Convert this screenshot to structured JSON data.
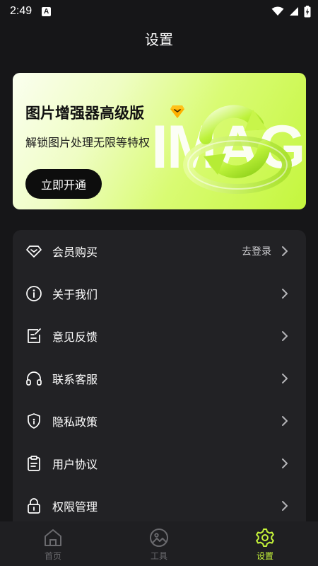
{
  "status_bar": {
    "time": "2:49",
    "notification_letter": "A"
  },
  "header": {
    "title": "设置"
  },
  "banner": {
    "title": "图片增强器高级版",
    "subtitle": "解锁图片处理无限等特权",
    "button_label": "立即开通",
    "background_text": "IMAGE",
    "accent_color": "#c4f63d"
  },
  "menu": {
    "items": [
      {
        "label": "会员购买",
        "right_text": "去登录",
        "icon": "diamond-icon"
      },
      {
        "label": "关于我们",
        "right_text": "",
        "icon": "info-icon"
      },
      {
        "label": "意见反馈",
        "right_text": "",
        "icon": "edit-note-icon"
      },
      {
        "label": "联系客服",
        "right_text": "",
        "icon": "headset-icon"
      },
      {
        "label": "隐私政策",
        "right_text": "",
        "icon": "shield-icon"
      },
      {
        "label": "用户协议",
        "right_text": "",
        "icon": "clipboard-icon"
      },
      {
        "label": "权限管理",
        "right_text": "",
        "icon": "lock-icon"
      }
    ]
  },
  "tab_bar": {
    "tabs": [
      {
        "label": "首页",
        "icon": "home-icon",
        "active": false
      },
      {
        "label": "工具",
        "icon": "image-icon",
        "active": false
      },
      {
        "label": "设置",
        "icon": "gear-icon",
        "active": true
      }
    ],
    "active_color": "#c5f43a"
  }
}
